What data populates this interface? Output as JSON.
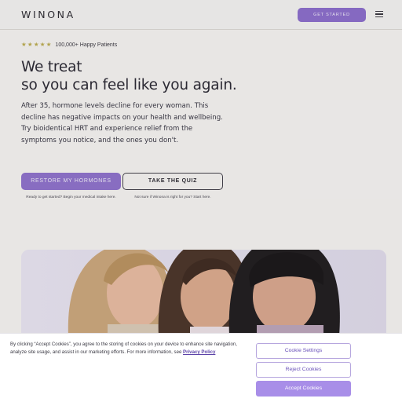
{
  "header": {
    "logo": "WINONA",
    "cta_label": "GET STARTED",
    "menu_icon": "hamburger-menu-icon"
  },
  "hero": {
    "stars_icon": "star-icon",
    "star_count": 5,
    "star_color": "#b8a94e",
    "rating_text": "100,000+ Happy Patients",
    "headline_line1": "We treat",
    "headline_line2": "so you can feel like you again.",
    "body": "After 35, hormone levels decline for every woman. This decline has negative impacts on your health and wellbeing. Try bioidentical HRT and experience relief from the symptoms you notice, and the ones you don't.",
    "primary_cta": "RESTORE MY HORMONES",
    "primary_note": "Ready to get started? Begin your medical intake here.",
    "secondary_cta": "TAKE THE QUIZ",
    "secondary_note": "Not sure if Winona is right for you? Start here."
  },
  "cookie_banner": {
    "text_before_link": "By clicking “Accept Cookies”, you agree to the storing of cookies on your device to enhance site navigation, analyze site usage, and assist in our marketing efforts. For more information, see ",
    "link_text": "Privacy Policy",
    "settings_label": "Cookie Settings",
    "reject_label": "Reject Cookies",
    "accept_label": "Accept Cookies"
  },
  "colors": {
    "accent": "#8a6cc9",
    "accept_button": "#a88ee8",
    "background": "#f3f1ef"
  }
}
